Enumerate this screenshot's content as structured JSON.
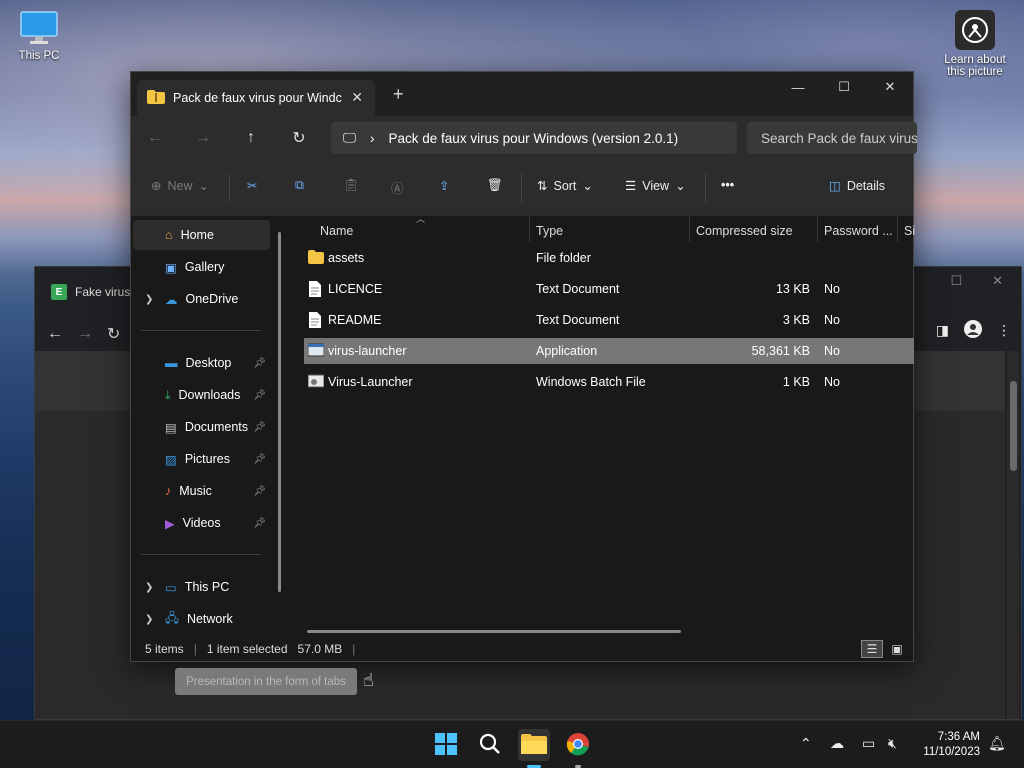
{
  "desktop": {
    "this_pc_label": "This PC",
    "learn_label_line1": "Learn about",
    "learn_label_line2": "this picture"
  },
  "background_window": {
    "tab_title": "Fake virus",
    "tab_favicon_letter": "E"
  },
  "explorer": {
    "tab_title": "Pack de faux virus pour Windc",
    "address_path": "Pack de faux virus pour Windows (version 2.0.1)",
    "search_placeholder": "Search Pack de faux virus",
    "toolbar": {
      "new_label": "New",
      "sort_label": "Sort",
      "view_label": "View",
      "more_label": "•••",
      "details_label": "Details"
    },
    "sidebar": {
      "items": [
        {
          "label": "Home",
          "icon": "home-icon"
        },
        {
          "label": "Gallery",
          "icon": "gallery-icon"
        },
        {
          "label": "OneDrive",
          "icon": "onedrive-icon"
        },
        {
          "label": "Desktop",
          "icon": "desktop-icon"
        },
        {
          "label": "Downloads",
          "icon": "downloads-icon"
        },
        {
          "label": "Documents",
          "icon": "documents-icon"
        },
        {
          "label": "Pictures",
          "icon": "pictures-icon"
        },
        {
          "label": "Music",
          "icon": "music-icon"
        },
        {
          "label": "Videos",
          "icon": "videos-icon"
        },
        {
          "label": "This PC",
          "icon": "this-pc-icon"
        },
        {
          "label": "Network",
          "icon": "network-icon"
        }
      ]
    },
    "columns": {
      "name": "Name",
      "type": "Type",
      "size": "Compressed size",
      "password": "Password ...",
      "extra": "Si"
    },
    "files": [
      {
        "name": "assets",
        "type": "File folder",
        "size": "",
        "password": ""
      },
      {
        "name": "LICENCE",
        "type": "Text Document",
        "size": "13 KB",
        "password": "No"
      },
      {
        "name": "README",
        "type": "Text Document",
        "size": "3 KB",
        "password": "No"
      },
      {
        "name": "virus-launcher",
        "type": "Application",
        "size": "58,361 KB",
        "password": "No"
      },
      {
        "name": "Virus-Launcher",
        "type": "Windows Batch File",
        "size": "1 KB",
        "password": "No"
      }
    ],
    "status": {
      "items": "5 items",
      "selected": "1 item selected",
      "size": "57.0 MB"
    }
  },
  "tooltip": "Presentation in the form of tabs",
  "taskbar": {
    "time": "7:36 AM",
    "date": "11/10/2023"
  }
}
